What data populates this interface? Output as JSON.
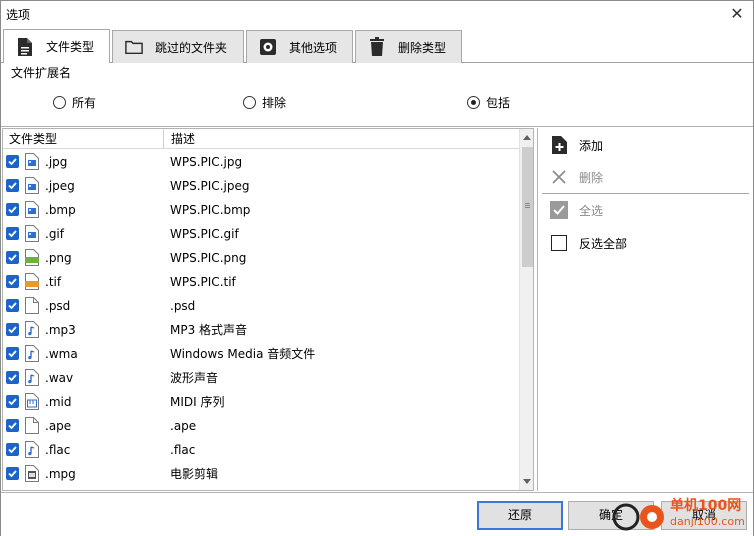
{
  "window": {
    "title": "选项",
    "close_glyph": "✕"
  },
  "tabs": [
    {
      "label": "文件类型",
      "icon": "document-icon",
      "active": true
    },
    {
      "label": "跳过的文件夹",
      "icon": "folder-icon",
      "active": false
    },
    {
      "label": "其他选项",
      "icon": "gear-icon",
      "active": false
    },
    {
      "label": "删除类型",
      "icon": "trash-icon",
      "active": false
    }
  ],
  "extension_section": {
    "label": "文件扩展名",
    "options": [
      {
        "label": "所有",
        "selected": false
      },
      {
        "label": "排除",
        "selected": false
      },
      {
        "label": "包括",
        "selected": true
      }
    ]
  },
  "list": {
    "columns": [
      "文件类型",
      "描述"
    ],
    "rows": [
      {
        "ext": ".jpg",
        "desc": "WPS.PIC.jpg",
        "checked": true,
        "icon": "image-file-icon"
      },
      {
        "ext": ".jpeg",
        "desc": "WPS.PIC.jpeg",
        "checked": true,
        "icon": "image-file-icon"
      },
      {
        "ext": ".bmp",
        "desc": "WPS.PIC.bmp",
        "checked": true,
        "icon": "image-file-icon"
      },
      {
        "ext": ".gif",
        "desc": "WPS.PIC.gif",
        "checked": true,
        "icon": "image-file-icon"
      },
      {
        "ext": ".png",
        "desc": "WPS.PIC.png",
        "checked": true,
        "icon": "png-file-icon"
      },
      {
        "ext": ".tif",
        "desc": "WPS.PIC.tif",
        "checked": true,
        "icon": "tiff-file-icon"
      },
      {
        "ext": ".psd",
        "desc": ".psd",
        "checked": true,
        "icon": "blank-file-icon"
      },
      {
        "ext": ".mp3",
        "desc": "MP3 格式声音",
        "checked": true,
        "icon": "audio-file-icon"
      },
      {
        "ext": ".wma",
        "desc": "Windows Media 音频文件",
        "checked": true,
        "icon": "audio-file-icon"
      },
      {
        "ext": ".wav",
        "desc": "波形声音",
        "checked": true,
        "icon": "audio-file-icon"
      },
      {
        "ext": ".mid",
        "desc": "MIDI 序列",
        "checked": true,
        "icon": "midi-file-icon"
      },
      {
        "ext": ".ape",
        "desc": ".ape",
        "checked": true,
        "icon": "blank-file-icon"
      },
      {
        "ext": ".flac",
        "desc": ".flac",
        "checked": true,
        "icon": "audio-file-icon"
      },
      {
        "ext": ".mpg",
        "desc": "电影剪辑",
        "checked": true,
        "icon": "video-file-icon"
      }
    ]
  },
  "side_actions": {
    "add": "添加",
    "delete": "删除",
    "select_all": "全选",
    "invert_selection": "反选全部"
  },
  "footer": {
    "restore": "还原",
    "ok": "确定",
    "cancel": "取消"
  },
  "watermark": {
    "site_name": "单机100网",
    "site_url": "danji100.com"
  },
  "colors": {
    "checkbox": "#1e63c7",
    "default_button_border": "#3a78d8",
    "watermark": "#e8541c"
  }
}
